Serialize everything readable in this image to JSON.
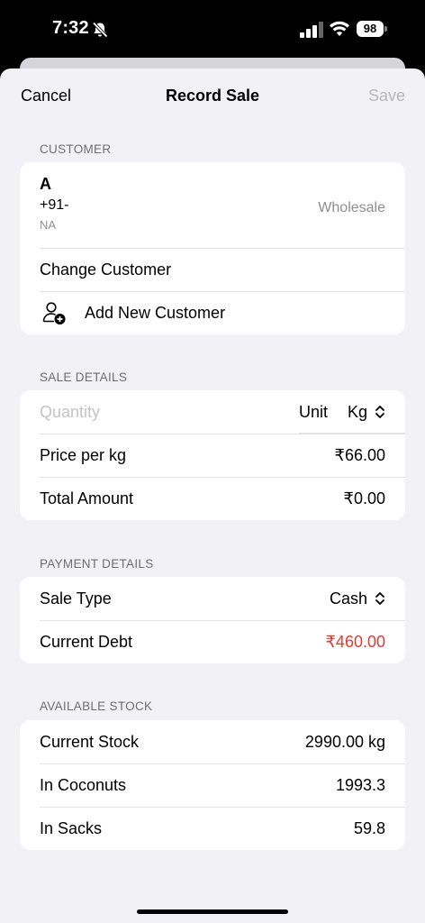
{
  "status_bar": {
    "time": "7:32",
    "battery": "98"
  },
  "nav": {
    "cancel": "Cancel",
    "title": "Record Sale",
    "save": "Save"
  },
  "customer": {
    "header": "CUSTOMER",
    "name": "A",
    "phone": "+91-",
    "city": "NA",
    "type": "Wholesale",
    "change_label": "Change Customer",
    "add_label": "Add New Customer"
  },
  "sale_details": {
    "header": "SALE DETAILS",
    "quantity_placeholder": "Quantity",
    "unit_label": "Unit",
    "unit_value": "Kg",
    "price_label": "Price per kg",
    "price_value": "₹66.00",
    "total_label": "Total Amount",
    "total_value": "₹0.00"
  },
  "payment_details": {
    "header": "PAYMENT DETAILS",
    "sale_type_label": "Sale Type",
    "sale_type_value": "Cash",
    "debt_label": "Current Debt",
    "debt_value": "₹460.00",
    "debt_color": "#e8392f"
  },
  "available_stock": {
    "header": "AVAILABLE STOCK",
    "stock_label": "Current Stock",
    "stock_value": "2990.00 kg",
    "coconuts_label": "In Coconuts",
    "coconuts_value": "1993.3",
    "sacks_label": "In Sacks",
    "sacks_value": "59.8"
  },
  "icons": {
    "bell": "bell-slash-icon",
    "signal": "cellular-signal-icon",
    "wifi": "wifi-icon",
    "battery": "battery-icon",
    "add_person": "person-add-icon",
    "chevron": "chevron-up-down-icon"
  }
}
